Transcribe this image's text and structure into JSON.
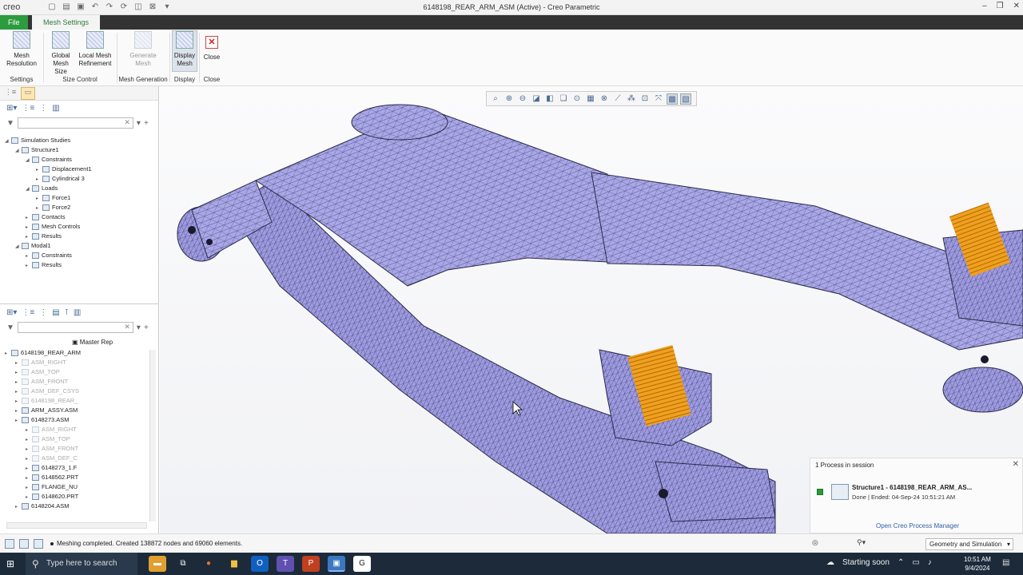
{
  "titlebar": {
    "app_logo": "creo",
    "title": "6148198_REAR_ARM_ASM (Active) - Creo Parametric"
  },
  "tabs": {
    "file": "File",
    "mesh_settings": "Mesh Settings"
  },
  "ribbon": {
    "mesh_resolution": "Mesh\nResolution",
    "global_mesh_size": "Global\nMesh Size",
    "local_mesh_refinement": "Local Mesh\nRefinement",
    "generate_mesh": "Generate\nMesh",
    "display_mesh": "Display\nMesh",
    "close": "Close",
    "group_settings": "Settings",
    "group_size_control": "Size Control",
    "group_mesh_generation": "Mesh Generation",
    "group_display": "Display",
    "group_close": "Close"
  },
  "sim_tree": [
    {
      "label": "Simulation Studies",
      "indent": 0,
      "expanded": true
    },
    {
      "label": "Structure1",
      "indent": 1,
      "expanded": true
    },
    {
      "label": "Constraints",
      "indent": 2,
      "expanded": true
    },
    {
      "label": "Displacement1",
      "indent": 3
    },
    {
      "label": "Cylindrical 3",
      "indent": 3
    },
    {
      "label": "Loads",
      "indent": 2,
      "expanded": true
    },
    {
      "label": "Force1",
      "indent": 3
    },
    {
      "label": "Force2",
      "indent": 3
    },
    {
      "label": "Contacts",
      "indent": 2
    },
    {
      "label": "Mesh Controls",
      "indent": 2
    },
    {
      "label": "Results",
      "indent": 2
    },
    {
      "label": "Modal1",
      "indent": 1,
      "expanded": true
    },
    {
      "label": "Constraints",
      "indent": 2
    },
    {
      "label": "Results",
      "indent": 2
    }
  ],
  "model_tree": {
    "master_rep": "Master Rep",
    "items": [
      {
        "label": "6148198_REAR_ARM",
        "indent": 0,
        "grey": false
      },
      {
        "label": "ASM_RIGHT",
        "indent": 1,
        "grey": true
      },
      {
        "label": "ASM_TOP",
        "indent": 1,
        "grey": true
      },
      {
        "label": "ASM_FRONT",
        "indent": 1,
        "grey": true
      },
      {
        "label": "ASM_DEF_CSYS",
        "indent": 1,
        "grey": true
      },
      {
        "label": "6148198_REAR_",
        "indent": 1,
        "grey": true
      },
      {
        "label": "ARM_ASSY.ASM",
        "indent": 1,
        "grey": false
      },
      {
        "label": "6148273.ASM",
        "indent": 1,
        "grey": false
      },
      {
        "label": "ASM_RIGHT",
        "indent": 2,
        "grey": true
      },
      {
        "label": "ASM_TOP",
        "indent": 2,
        "grey": true
      },
      {
        "label": "ASM_FRONT",
        "indent": 2,
        "grey": true
      },
      {
        "label": "ASM_DEF_C",
        "indent": 2,
        "grey": true
      },
      {
        "label": "6148273_1.F",
        "indent": 2,
        "grey": false
      },
      {
        "label": "6148562.PRT",
        "indent": 2,
        "grey": false
      },
      {
        "label": "FLANGE_NU",
        "indent": 2,
        "grey": false
      },
      {
        "label": "6148620.PRT",
        "indent": 2,
        "grey": false
      },
      {
        "label": "6148204.ASM",
        "indent": 1,
        "grey": false
      }
    ]
  },
  "process": {
    "header": "1 Process in session",
    "name": "Structure1 - 6148198_REAR_ARM_AS...",
    "status": "Done | Ended: 04-Sep-24 10:51:21 AM",
    "link": "Open Creo Process Manager"
  },
  "statusbar": {
    "message": "Meshing completed. Created 138872 nodes and 69060 elements.",
    "mode": "Geometry and Simulation"
  },
  "taskbar": {
    "search_placeholder": "Type here to search",
    "weather": "Starting soon",
    "time": "10:51 AM",
    "date": "9/4/2024"
  },
  "colors": {
    "mesh_fill": "#a9a7e8",
    "mesh_line": "#2a2a4a",
    "load_glyph": "#f0a020",
    "file_tab": "#2d9b3f",
    "taskbar": "#1c2a3a"
  }
}
